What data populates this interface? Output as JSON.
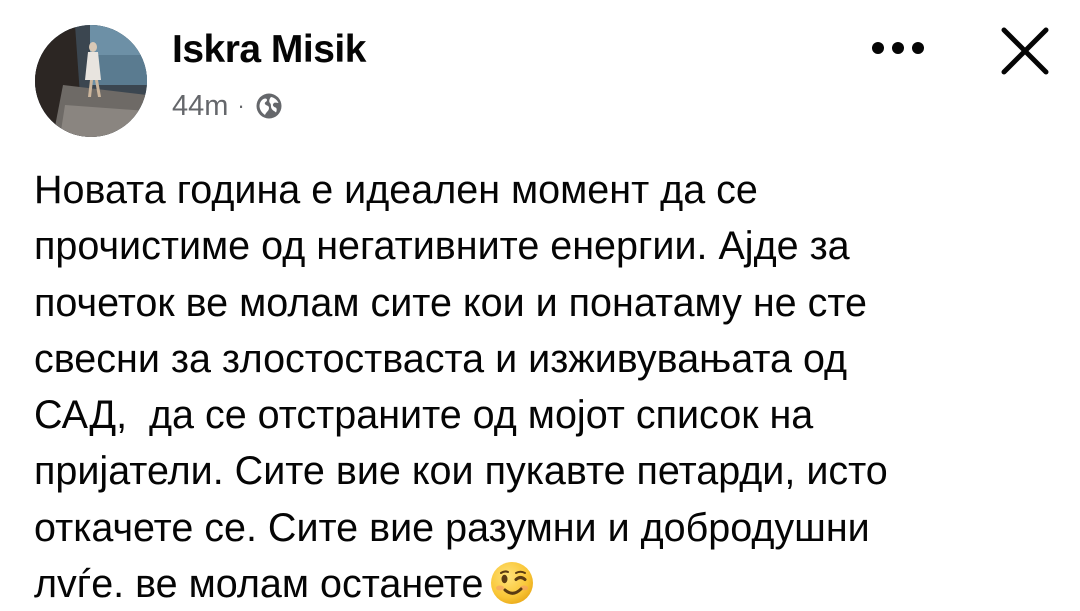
{
  "post": {
    "author": "Iskra Misik",
    "timestamp": "44m",
    "separator": "·",
    "privacy_icon": "globe-icon",
    "more_icon": "more-horizontal-icon",
    "close_icon": "close-icon",
    "body_lines": [
      "Новата година е идеален момент да се",
      "прочистиме од негативните енергии. Ајде за",
      "почеток ве молам сите кои и понатаму не сте",
      "свесни за злостостваста и изживувањата од",
      "САД,  да се отстраните од мојот список на",
      "пријатели. Сите вие кои пукавте петарди, исто",
      "откачете се. Сите вие разумни и добродушни",
      "лvѓе. ве молам останете"
    ],
    "emoji": "winking-face-icon"
  },
  "colors": {
    "text_primary": "#050505",
    "text_secondary": "#65676b",
    "background": "#ffffff"
  }
}
